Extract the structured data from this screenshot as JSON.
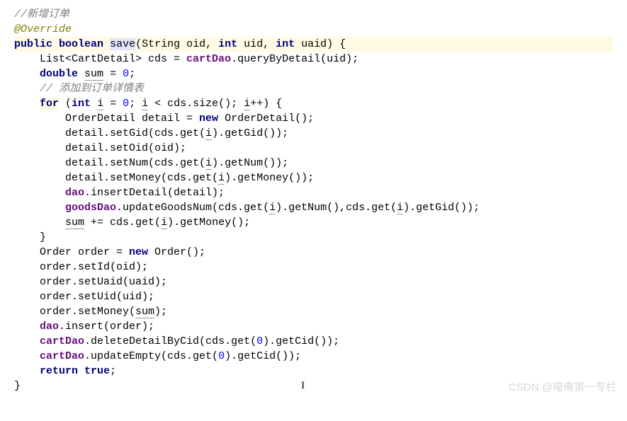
{
  "code": {
    "comment1": "//新增订单",
    "annotation": "@Override",
    "public": "public",
    "boolean": "boolean",
    "save": "save",
    "params": "(String oid, ",
    "int1": "int",
    "uid_param": " uid, ",
    "int2": "int",
    "uaid_param": " uaid) {",
    "list_line": "    List<CartDetail> cds = ",
    "cartDao1": "cartDao",
    "queryByDetail": ".queryByDetail(uid);",
    "double": "double",
    "sum_decl": "sum",
    "sum_init": " = ",
    "zero1": "0",
    "semi1": ";",
    "comment2": "    // 添加到订单详情表",
    "for": "for",
    "for_open": " (",
    "int3": "int",
    "i_decl": "i",
    "i_init": " = ",
    "zero2": "0",
    "loop_cond": "; ",
    "i_cond": "i",
    "cond_rest": " < cds.size(); ",
    "i_inc": "i",
    "inc_rest": "++) {",
    "detail_decl": "        OrderDetail detail = ",
    "new1": "new",
    "orderdetail_new": " OrderDetail();",
    "setGid_pre": "        detail.setGid(cds.get(",
    "i_g1": "i",
    "setGid_post": ").getGid());",
    "setOid": "        detail.setOid(oid);",
    "setNum_pre": "        detail.setNum(cds.get(",
    "i_g2": "i",
    "setNum_post": ").getNum());",
    "setMoney_pre": "        detail.setMoney(cds.get(",
    "i_g3": "i",
    "setMoney_post": ").getMoney());",
    "dao1_pre": "        ",
    "dao1": "dao",
    "insertDetail": ".insertDetail(detail);",
    "goodsDao_pre": "        ",
    "goodsDao": "goodsDao",
    "updateGoods_pre": ".updateGoodsNum(cds.get(",
    "i_g4": "i",
    "updateGoods_mid": ").getNum(),cds.get(",
    "i_g5": "i",
    "updateGoods_post": ").getGid());",
    "sum_add_pre": "        ",
    "sum_add": "sum",
    "sum_add_mid": " += cds.get(",
    "i_g6": "i",
    "sum_add_post": ").getMoney();",
    "for_close": "    }",
    "order_decl": "    Order order = ",
    "new2": "new",
    "order_new": " Order();",
    "setId": "    order.setId(oid);",
    "setUaid": "    order.setUaid(uaid);",
    "setUid": "    order.setUid(uid);",
    "setMoney2_pre": "    order.setMoney(",
    "sum_arg": "sum",
    "setMoney2_post": ");",
    "dao2_pre": "    ",
    "dao2": "dao",
    "insert": ".insert(order);",
    "cartDao2_pre": "    ",
    "cartDao2": "cartDao",
    "deleteDetail_pre": ".deleteDetailByCid(cds.get(",
    "zero3": "0",
    "deleteDetail_post": ").getCid());",
    "cartDao3_pre": "    ",
    "cartDao3": "cartDao",
    "updateEmpty_pre": ".updateEmpty(cds.get(",
    "zero4": "0",
    "updateEmpty_post": ").getCid());",
    "return_pre": "    ",
    "return": "return",
    "true": "true",
    "return_post": ";",
    "close": "}"
  },
  "watermark": "CSDN @喵俺第一专栏"
}
